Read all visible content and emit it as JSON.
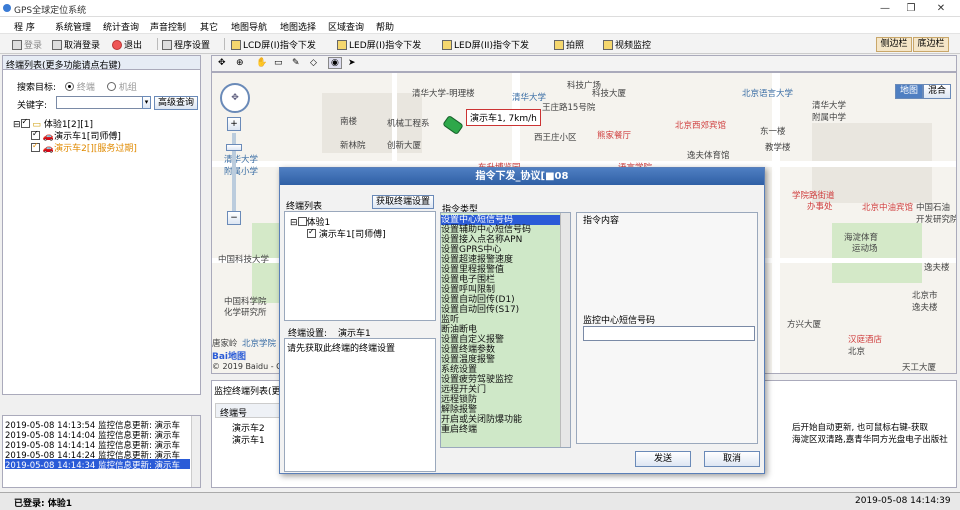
{
  "window": {
    "title": "GPS全球定位系统",
    "minimize": "—",
    "restore": "❐",
    "close": "✕"
  },
  "menu": [
    "程 序",
    "系统管理",
    "统计查询",
    "声音控制",
    "其它",
    "地图导航",
    "地图选择",
    "区域查询",
    "帮助"
  ],
  "toolbar": {
    "login": "登录",
    "cancel_login": "取消登录",
    "exit": "退出",
    "settings": "程序设置",
    "lcd1": "LCD屏(I)指令下发",
    "led1": "LED屏(I)指令下发",
    "led2": "LED屏(II)指令下发",
    "photo": "拍照",
    "video": "视频监控",
    "sidebar": "侧边栏",
    "bottombar": "底边栏"
  },
  "left_panel": {
    "header": "终端列表(更多功能请点右键)",
    "search_target": "搜索目标:",
    "opt_terminal": "终端",
    "opt_group": "机组",
    "keyword": "关键字:",
    "advanced": "高级查询",
    "tree": {
      "group": "体验1[2][1]",
      "car1": "演示车1[司师傅]",
      "car2": "演示车2[][服务过期]"
    }
  },
  "log": [
    "2019-05-08 14:13:54 监控信息更新: 演示车",
    "2019-05-08 14:14:04 监控信息更新: 演示车",
    "2019-05-08 14:14:14 监控信息更新: 演示车",
    "2019-05-08 14:14:24 监控信息更新: 演示车",
    "2019-05-08 14:14:34 监控信息更新: 演示车"
  ],
  "map": {
    "map_btn": "地图",
    "hybrid_btn": "混合",
    "vehicle_label": "演示车1, 7km/h",
    "copyright": "© 2019 Baidu - GS",
    "baidu": "Bai地图",
    "pois": [
      "清华大学-明理楼",
      "王庄路15号院",
      "科技广场",
      "清华大学",
      "科技大厦",
      "机械工程系",
      "南楼",
      "西王庄小区",
      "熊家餐厅",
      "北京西郊宾馆",
      "北京语言大学",
      "东一楼",
      "逸夫体育馆",
      "新林院",
      "创新大厦",
      "教学楼",
      "清华大学",
      "附属小学",
      "东升博览园",
      "语言学院",
      "学院路街道",
      "办事处",
      "北京中油宾馆",
      "中国科技大学",
      "海淀体育",
      "运动场",
      "逸夫楼",
      "中国科学院",
      "化学研究所",
      "中国石油",
      "开发研究院",
      "北京市",
      "方兴大厦",
      "北京",
      "汉庭酒店",
      "天工大厦",
      "唐家岭",
      "北京学院",
      "清华大学",
      "附属中学",
      "逸夫楼"
    ]
  },
  "bottom": {
    "header": "监控终端列表(更",
    "col": "终端号",
    "rows": [
      "演示车2",
      "演示车1"
    ],
    "info1": "后开始自动更新, 也可鼠标右键-获取",
    "info2": "海淀区双清路,嘉青华同方光盘电子出版社"
  },
  "status": {
    "login": "已登录: 体验1",
    "time": "2019-05-08 14:14:39"
  },
  "dialog": {
    "title": "指令下发_协议[■08",
    "terminal_list": "终端列表",
    "get_settings": "获取终端设置",
    "tree_group": "体验1",
    "tree_car": "演示车1[司师傅]",
    "terminal_setting_label": "终端设置:",
    "terminal_setting_value": "演示车1",
    "hint": "请先获取此终端的终端设置",
    "cmd_type": "指令类型",
    "commands": [
      "设置中心短信号码",
      "设置辅助中心短信号码",
      "设置接入点名称APN",
      "设置GPRS中心",
      "设置超速报警速度",
      "设置里程报警值",
      "设置电子围栏",
      "设置呼叫限制",
      "设置自动回传(D1)",
      "设置自动回传(S17)",
      "监听",
      "断油断电",
      "设置自定义报警",
      "设置终端参数",
      "设置温度报警",
      "系统设置",
      "设置疲劳驾驶监控",
      "远程开关门",
      "远程锁防",
      "解除报警",
      "开启或关闭防爆功能",
      "重启终端"
    ],
    "cmd_content": "指令内容",
    "field_label": "监控中心短信号码",
    "field_value": "",
    "send": "发送",
    "cancel": "取消"
  }
}
